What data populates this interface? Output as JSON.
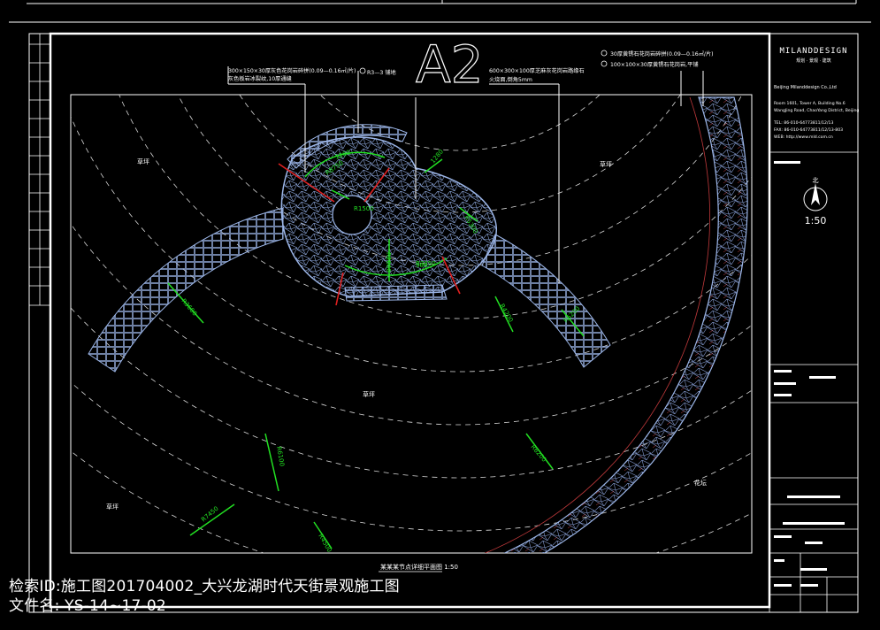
{
  "sheet": {
    "sheet_label": "A2",
    "plan_title": "某某某节点详细平面图 1:50",
    "scale": "1:50",
    "north_label": "北",
    "brand": "MILANDDESIGN",
    "brand_sub": "规划 · 景观 · 建筑",
    "company_en": "Beijing Milanddesign Co.,Ltd",
    "address_lines": [
      "Room 1601, Tower A, Building No.6",
      "WangJing Road, ChaoYang District, Beijing",
      "TEL: 86-010-64773811/12/13",
      "FAX: 86-010-64773811/12/13-803",
      "WEB: http://www.mld.com.cn"
    ]
  },
  "annotations": [
    {
      "id": "note-top-left",
      "text": "300×150×30厚灰色花岗岩碎拼(0.09—0.16㎡/片)"
    },
    {
      "id": "note-top-left-2",
      "text": "灰色板岩冰裂纹,10厚通缝"
    },
    {
      "id": "note-top-mid",
      "text": "R3—3 铺地"
    },
    {
      "id": "note-top-right",
      "text": "600×300×100厚芝麻灰花岗岩路缘石"
    },
    {
      "id": "note-top-right-2",
      "text": "火烧面,倒角5mm"
    },
    {
      "id": "note-far-right",
      "text": "30厚黄锈石花岗岩碎拼(0.09—0.16㎡/片)"
    },
    {
      "id": "note-far-right-2",
      "text": "100×100×30厚黄锈石花岗岩,平铺"
    }
  ],
  "dimensions": [
    "R8750",
    "R1500",
    "1280",
    "R5300",
    "R2860",
    "R3250",
    "R3600",
    "R4200",
    "R5200",
    "R6100",
    "R7450",
    "R4500",
    "R6200",
    "1200",
    "900"
  ],
  "area_labels": [
    "草坪",
    "草坪",
    "草坪",
    "草坪",
    "花坛"
  ],
  "captions": {
    "line1": "检索ID:施工图201704002_大兴龙湖时代天街景观施工图",
    "line2": "文件名: YS-14~17-02"
  }
}
